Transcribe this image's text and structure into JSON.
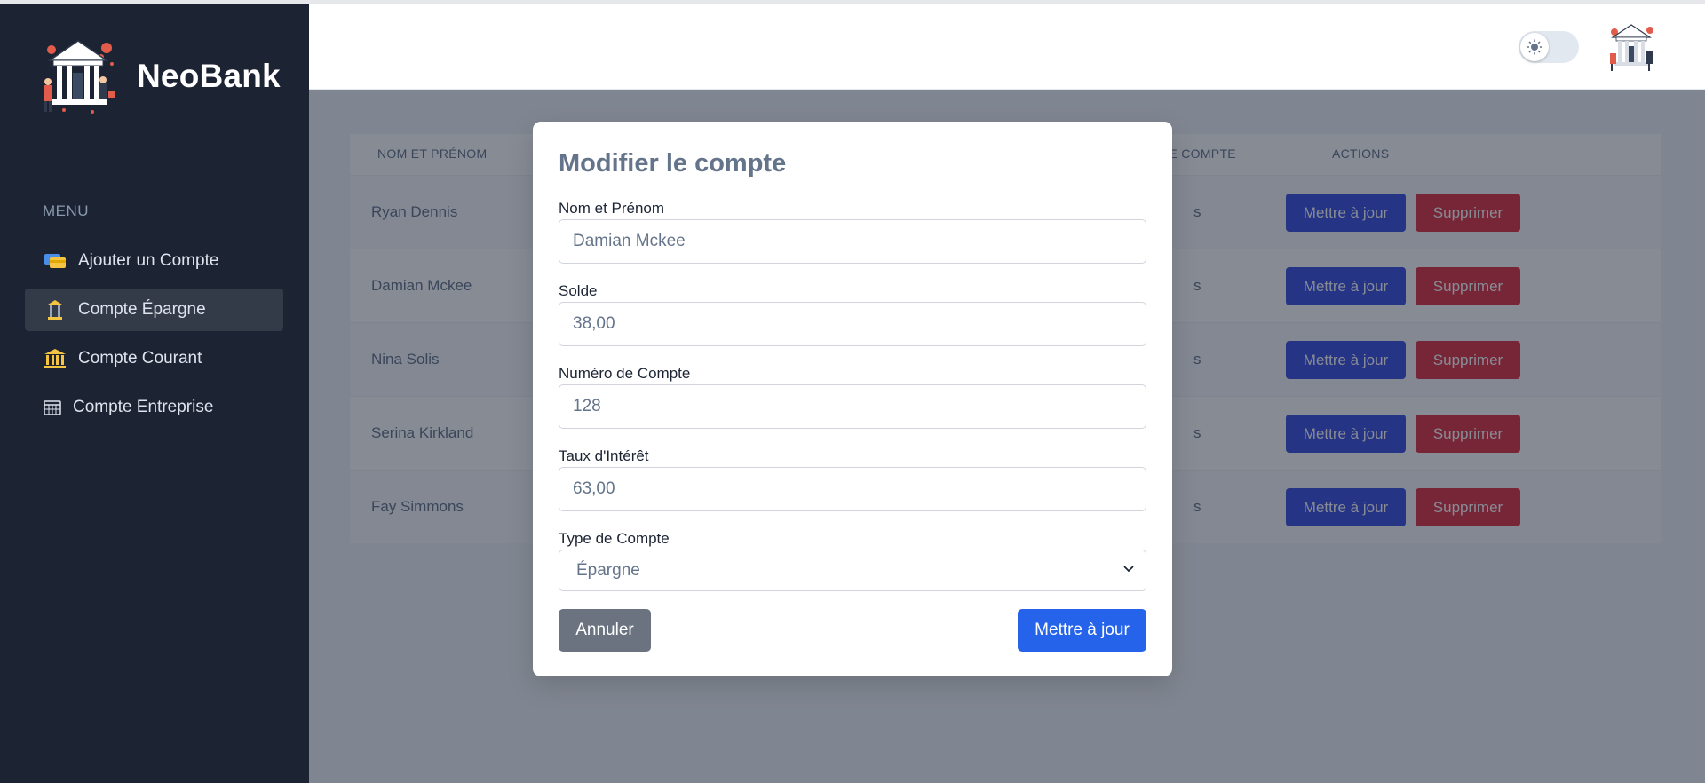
{
  "app": {
    "brand": "NeoBank"
  },
  "sidebar": {
    "menu_label": "MENU",
    "items": [
      {
        "label": "Ajouter un Compte",
        "icon": "cards-icon",
        "active": false
      },
      {
        "label": "Compte Épargne",
        "icon": "pillar-icon",
        "active": true
      },
      {
        "label": "Compte Courant",
        "icon": "bank-icon",
        "active": false
      },
      {
        "label": "Compte Entreprise",
        "icon": "calendar-icon",
        "active": false
      }
    ]
  },
  "header": {
    "theme_toggle": "light"
  },
  "table": {
    "columns": [
      "NOM ET PRÉNOM",
      "DE COMPTE",
      "ACTIONS"
    ],
    "rows": [
      {
        "name": "Ryan Dennis",
        "type_fragment": "s"
      },
      {
        "name": "Damian Mckee",
        "type_fragment": "s"
      },
      {
        "name": "Nina Solis",
        "type_fragment": "s"
      },
      {
        "name": "Serina Kirkland",
        "type_fragment": "s"
      },
      {
        "name": "Fay Simmons",
        "type_fragment": "s"
      }
    ],
    "update_label": "Mettre à jour",
    "delete_label": "Supprimer"
  },
  "modal": {
    "title": "Modifier le compte",
    "fields": {
      "name": {
        "label": "Nom et Prénom",
        "value": "Damian Mckee"
      },
      "balance": {
        "label": "Solde",
        "value": "38,00"
      },
      "account_number": {
        "label": "Numéro de Compte",
        "value": "128"
      },
      "interest_rate": {
        "label": "Taux d'Intérêt",
        "value": "63,00"
      },
      "account_type": {
        "label": "Type de Compte",
        "value": "Épargne"
      }
    },
    "cancel_label": "Annuler",
    "submit_label": "Mettre à jour"
  },
  "colors": {
    "sidebar_bg": "#1c2434",
    "primary": "#3c50e0",
    "danger": "#dc3545",
    "submit": "#2563eb",
    "cancel": "#6b7280"
  }
}
